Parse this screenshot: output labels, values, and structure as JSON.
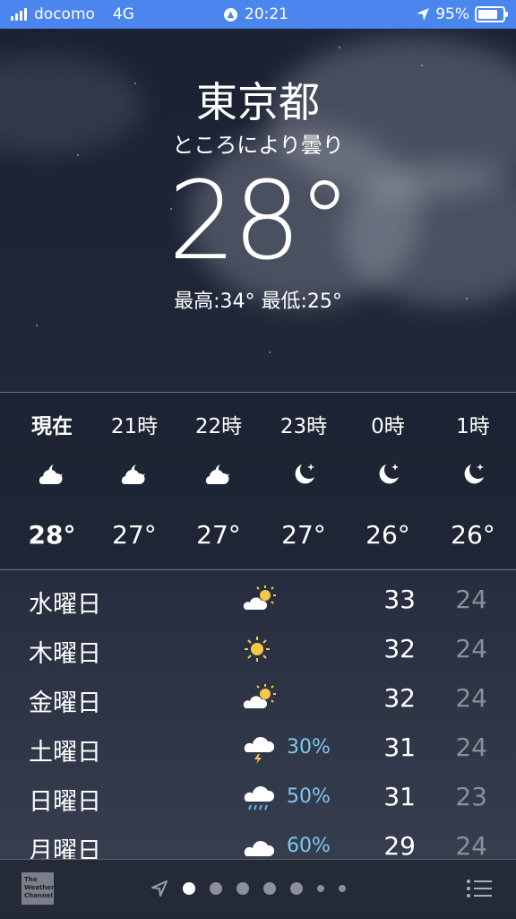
{
  "status": {
    "carrier": "docomo",
    "network": "4G",
    "time": "20:21",
    "battery_text": "95%",
    "battery_level": 0.95,
    "accent": "#4a86ee"
  },
  "header": {
    "city": "東京都",
    "condition": "ところにより曇り",
    "temperature": "28°",
    "hilo": "最高:34° 最低:25°"
  },
  "hourly": [
    {
      "label": "現在",
      "icon": "moon-cloud-icon",
      "temp": "28°"
    },
    {
      "label": "21時",
      "icon": "moon-cloud-icon",
      "temp": "27°"
    },
    {
      "label": "22時",
      "icon": "moon-cloud-icon",
      "temp": "27°"
    },
    {
      "label": "23時",
      "icon": "moon-stars-icon",
      "temp": "27°"
    },
    {
      "label": "0時",
      "icon": "moon-stars-icon",
      "temp": "26°"
    },
    {
      "label": "1時",
      "icon": "moon-stars-icon",
      "temp": "26°"
    }
  ],
  "daily": [
    {
      "day": "水曜日",
      "icon": "partly-sunny-icon",
      "pop": "",
      "hi": "33",
      "lo": "24"
    },
    {
      "day": "木曜日",
      "icon": "sun-icon",
      "pop": "",
      "hi": "32",
      "lo": "24"
    },
    {
      "day": "金曜日",
      "icon": "partly-sunny-icon",
      "pop": "",
      "hi": "32",
      "lo": "24"
    },
    {
      "day": "土曜日",
      "icon": "thunderstorm-icon",
      "pop": "30%",
      "hi": "31",
      "lo": "24"
    },
    {
      "day": "日曜日",
      "icon": "rain-icon",
      "pop": "50%",
      "hi": "31",
      "lo": "23"
    },
    {
      "day": "月曜日",
      "icon": "cloud-icon",
      "pop": "60%",
      "hi": "29",
      "lo": "24"
    }
  ],
  "footer": {
    "logo_text": "The Weather Channel",
    "pages": 7,
    "active_page": 0
  }
}
